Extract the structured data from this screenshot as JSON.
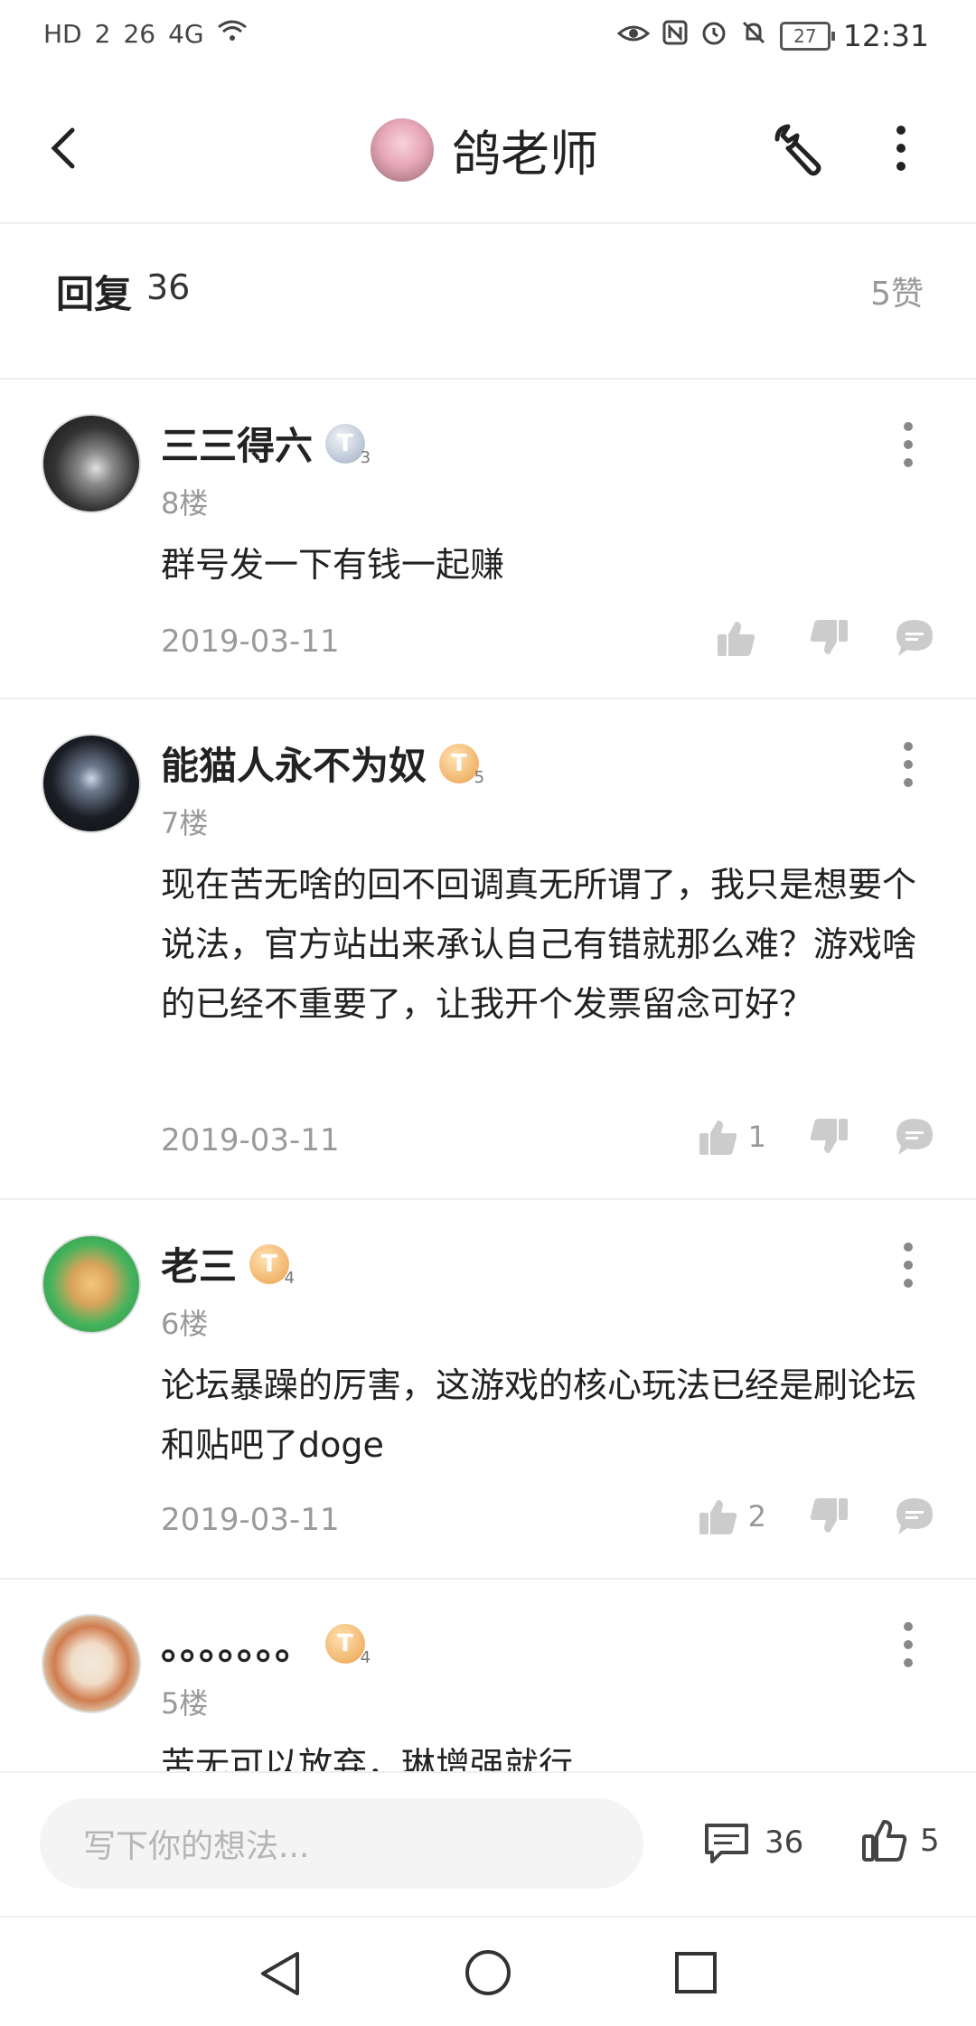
{
  "statusbar": {
    "left_icons": [
      "HD",
      "2",
      "26",
      "4G",
      "wifi"
    ],
    "right_icons": [
      "eye-icon",
      "nfc-icon",
      "alarm-icon",
      "mute-icon"
    ],
    "battery": "27",
    "time": "12:31"
  },
  "appbar": {
    "title": "鸽老师"
  },
  "replies": {
    "title": "回复",
    "count": "36",
    "likes": "5赞"
  },
  "comments": [
    {
      "username": "三三得六",
      "badge": "T",
      "badge_level": "3",
      "floor": "8楼",
      "content": "群号发一下有钱一起赚",
      "date": "2019-03-11",
      "likes": ""
    },
    {
      "username": "能猫人永不为奴",
      "badge": "T",
      "badge_level": "5",
      "floor": "7楼",
      "content": "现在苦无啥的回不回调真无所谓了，我只是想要个说法，官方站出来承认自己有错就那么难？游戏啥的已经不重要了，让我开个发票留念可好？",
      "date": "2019-03-11",
      "likes": "1"
    },
    {
      "username": "老三",
      "badge": "T",
      "badge_level": "4",
      "floor": "6楼",
      "content": "论坛暴躁的厉害，这游戏的核心玩法已经是刷论坛和贴吧了doge",
      "date": "2019-03-11",
      "likes": "2"
    },
    {
      "username": "。。。。。。。",
      "badge": "T",
      "badge_level": "4",
      "floor": "5楼",
      "content": "苦无可以放弃，琳增强就行",
      "date": "",
      "likes": ""
    }
  ],
  "bottom": {
    "placeholder": "写下你的想法...",
    "comments_count": "36",
    "likes_count": "5"
  }
}
